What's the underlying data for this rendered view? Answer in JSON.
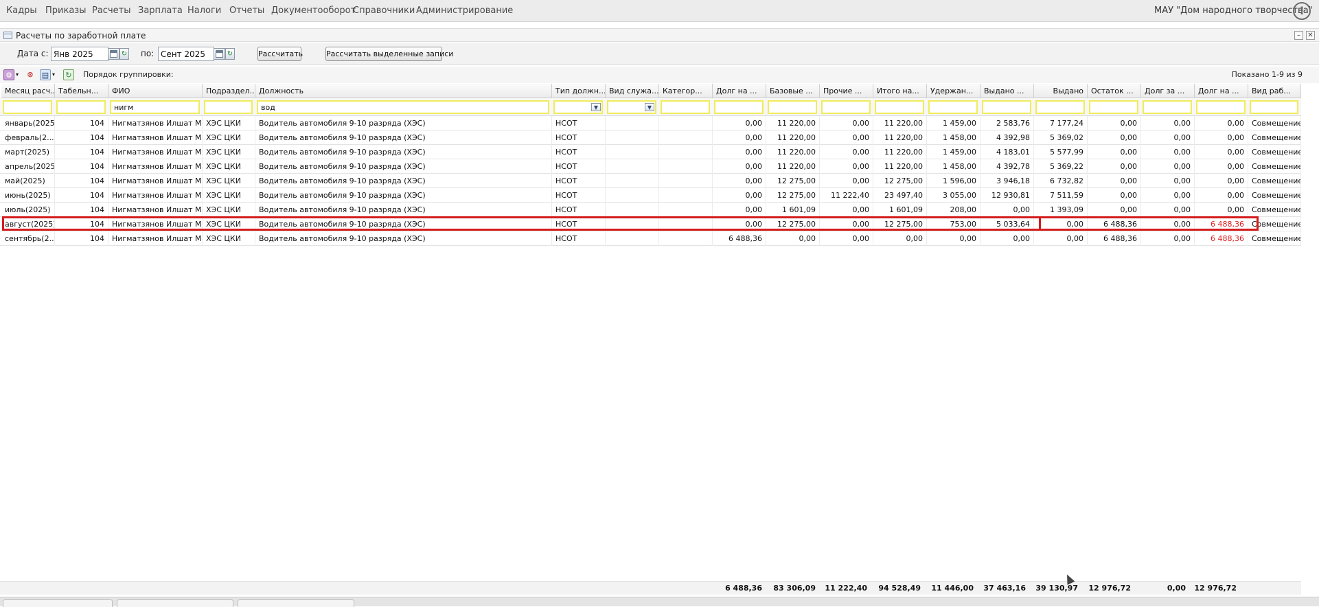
{
  "menu": {
    "items": [
      "Кадры",
      "Приказы",
      "Расчеты",
      "Зарплата",
      "Налоги",
      "Отчеты",
      "Документооборот",
      "Справочники",
      "Администрирование"
    ],
    "org": "МАУ \"Дом народного творчества\"",
    "alert_symbol": "!"
  },
  "window": {
    "title": "Расчеты по заработной плате",
    "minimize": "–",
    "close": "✕"
  },
  "toolbar": {
    "date_from_label": "Дата с:",
    "date_from": "Янв 2025",
    "date_to_label": "по:",
    "date_to": "Сент 2025",
    "calc_button": "Рассчитать",
    "calc_selected_button": "Рассчитать выделенные записи"
  },
  "gridbar": {
    "grouping_label": "Порядок группировки:",
    "shown": "Показано 1-9 из 9"
  },
  "columns": [
    "Месяц расч...",
    "Табельн...",
    "ФИО",
    "Подраздел...",
    "Должность",
    "Тип должн...",
    "Вид служа...",
    "Категор...",
    "Долг на ...",
    "Базовые ...",
    "Прочие ...",
    "Итого на...",
    "Удержан...",
    "Выдано ...",
    "Выдано",
    "Остаток ...",
    "Долг за ...",
    "Долг на ...",
    "Вид раб..."
  ],
  "filters": {
    "fio": "нигм",
    "position": "вод"
  },
  "rows": [
    [
      "январь(2025)",
      "104",
      "Нигматзянов Илшат М...",
      "ХЭС ЦКИ",
      "Водитель автомобиля 9-10 разряда (ХЭС)",
      "НСОТ",
      "",
      "",
      "0,00",
      "11 220,00",
      "0,00",
      "11 220,00",
      "1 459,00",
      "2 583,76",
      "7 177,24",
      "0,00",
      "0,00",
      "0,00",
      "Совмещение"
    ],
    [
      "февраль(2...",
      "104",
      "Нигматзянов Илшат М...",
      "ХЭС ЦКИ",
      "Водитель автомобиля 9-10 разряда (ХЭС)",
      "НСОТ",
      "",
      "",
      "0,00",
      "11 220,00",
      "0,00",
      "11 220,00",
      "1 458,00",
      "4 392,98",
      "5 369,02",
      "0,00",
      "0,00",
      "0,00",
      "Совмещение"
    ],
    [
      "март(2025)",
      "104",
      "Нигматзянов Илшат М...",
      "ХЭС ЦКИ",
      "Водитель автомобиля 9-10 разряда (ХЭС)",
      "НСОТ",
      "",
      "",
      "0,00",
      "11 220,00",
      "0,00",
      "11 220,00",
      "1 459,00",
      "4 183,01",
      "5 577,99",
      "0,00",
      "0,00",
      "0,00",
      "Совмещение"
    ],
    [
      "апрель(2025)",
      "104",
      "Нигматзянов Илшат М...",
      "ХЭС ЦКИ",
      "Водитель автомобиля 9-10 разряда (ХЭС)",
      "НСОТ",
      "",
      "",
      "0,00",
      "11 220,00",
      "0,00",
      "11 220,00",
      "1 458,00",
      "4 392,78",
      "5 369,22",
      "0,00",
      "0,00",
      "0,00",
      "Совмещение"
    ],
    [
      "май(2025)",
      "104",
      "Нигматзянов Илшат М...",
      "ХЭС ЦКИ",
      "Водитель автомобиля 9-10 разряда (ХЭС)",
      "НСОТ",
      "",
      "",
      "0,00",
      "12 275,00",
      "0,00",
      "12 275,00",
      "1 596,00",
      "3 946,18",
      "6 732,82",
      "0,00",
      "0,00",
      "0,00",
      "Совмещение"
    ],
    [
      "июнь(2025)",
      "104",
      "Нигматзянов Илшат М...",
      "ХЭС ЦКИ",
      "Водитель автомобиля 9-10 разряда (ХЭС)",
      "НСОТ",
      "",
      "",
      "0,00",
      "12 275,00",
      "11 222,40",
      "23 497,40",
      "3 055,00",
      "12 930,81",
      "7 511,59",
      "0,00",
      "0,00",
      "0,00",
      "Совмещение"
    ],
    [
      "июль(2025)",
      "104",
      "Нигматзянов Илшат М...",
      "ХЭС ЦКИ",
      "Водитель автомобиля 9-10 разряда (ХЭС)",
      "НСОТ",
      "",
      "",
      "0,00",
      "1 601,09",
      "0,00",
      "1 601,09",
      "208,00",
      "0,00",
      "1 393,09",
      "0,00",
      "0,00",
      "0,00",
      "Совмещение"
    ],
    [
      "август(2025)",
      "104",
      "Нигматзянов Илшат М...",
      "ХЭС ЦКИ",
      "Водитель автомобиля 9-10 разряда (ХЭС)",
      "НСОТ",
      "",
      "",
      "0,00",
      "12 275,00",
      "0,00",
      "12 275,00",
      "753,00",
      "5 033,64",
      "0,00",
      "6 488,36",
      "0,00",
      "6 488,36",
      "Совмещение"
    ],
    [
      "сентябрь(2...",
      "104",
      "Нигматзянов Илшат М...",
      "ХЭС ЦКИ",
      "Водитель автомобиля 9-10 разряда (ХЭС)",
      "НСОТ",
      "",
      "",
      "6 488,36",
      "0,00",
      "0,00",
      "0,00",
      "0,00",
      "0,00",
      "0,00",
      "6 488,36",
      "0,00",
      "6 488,36",
      "Совмещение"
    ]
  ],
  "totals": [
    "6 488,36",
    "83 306,09",
    "11 222,40",
    "94 528,49",
    "11 446,00",
    "37 463,16",
    "39 130,97",
    "12 976,72",
    "0,00",
    "12 976,72"
  ],
  "colors": {
    "highlight": "#d41b1b",
    "filter_border": "#f0ec5a",
    "debt_text": "#e02020"
  }
}
